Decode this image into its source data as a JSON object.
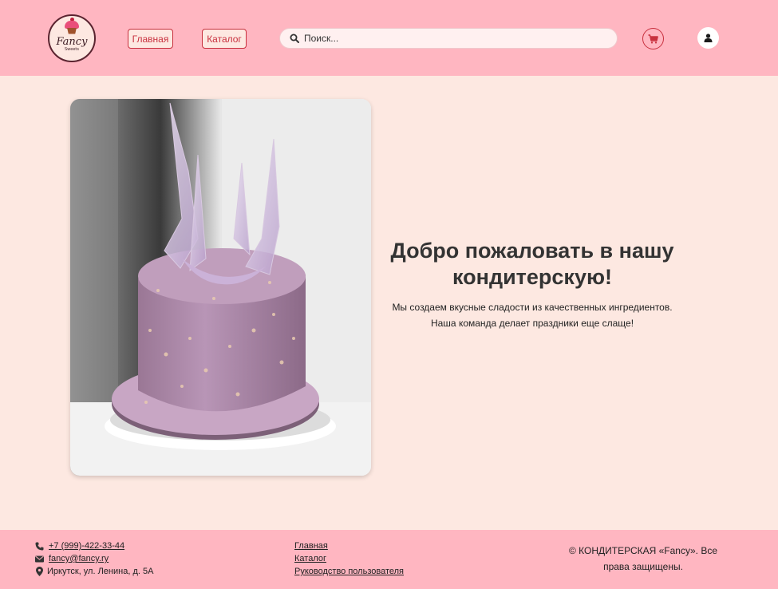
{
  "header": {
    "logo": {
      "brand": "Fancy",
      "sub": "Sweets"
    },
    "nav": {
      "home": "Главная",
      "catalog": "Каталог"
    },
    "search": {
      "placeholder": "Поиск..."
    },
    "colors": {
      "header_bg": "#ffb6c1",
      "accent": "#c8303e",
      "page_bg": "#fde8e1"
    },
    "icons": {
      "search": "search-icon",
      "cart": "cart-icon",
      "user": "user-icon"
    }
  },
  "hero": {
    "title": "Добро пожаловать в нашу кондитерскую!",
    "text": "Мы создаем вкусные сладости из качественных ингредиентов. Наша команда делает праздники еще слаще!"
  },
  "footer": {
    "phone": "+7 (999)-422-33-44",
    "email": "fancy@fancy.ry",
    "address": "Иркутск, ул. Ленина, д. 5А",
    "links": [
      "Главная",
      "Каталог",
      "Руководство пользователя"
    ],
    "copyright": "© КОНДИТЕРСКАЯ «Fancy». Все права защищены."
  }
}
